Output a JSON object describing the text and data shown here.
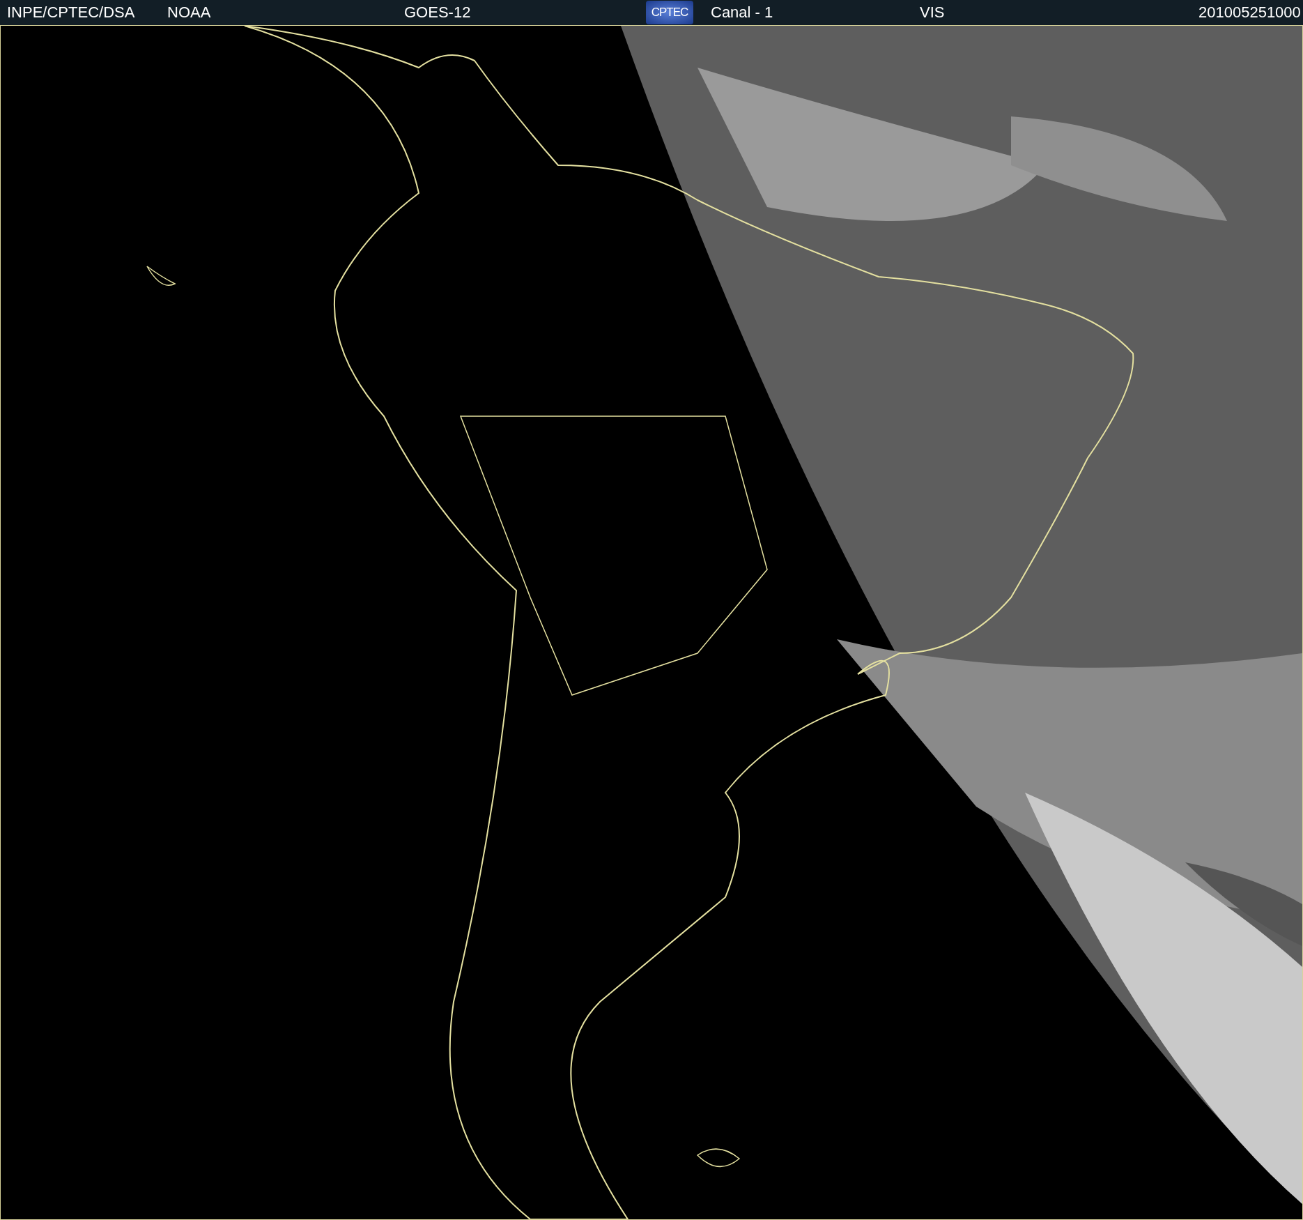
{
  "header": {
    "items": [
      {
        "kind": "text",
        "text": "INPE/CPTEC/DSA"
      },
      {
        "kind": "text",
        "text": "NOAA"
      },
      {
        "kind": "text",
        "text": "GOES-12"
      },
      {
        "kind": "logo",
        "text": "CPTEC"
      },
      {
        "kind": "text",
        "text": "Canal - 1"
      },
      {
        "kind": "text",
        "text": "VIS"
      },
      {
        "kind": "text",
        "text": "201005251000"
      }
    ]
  }
}
